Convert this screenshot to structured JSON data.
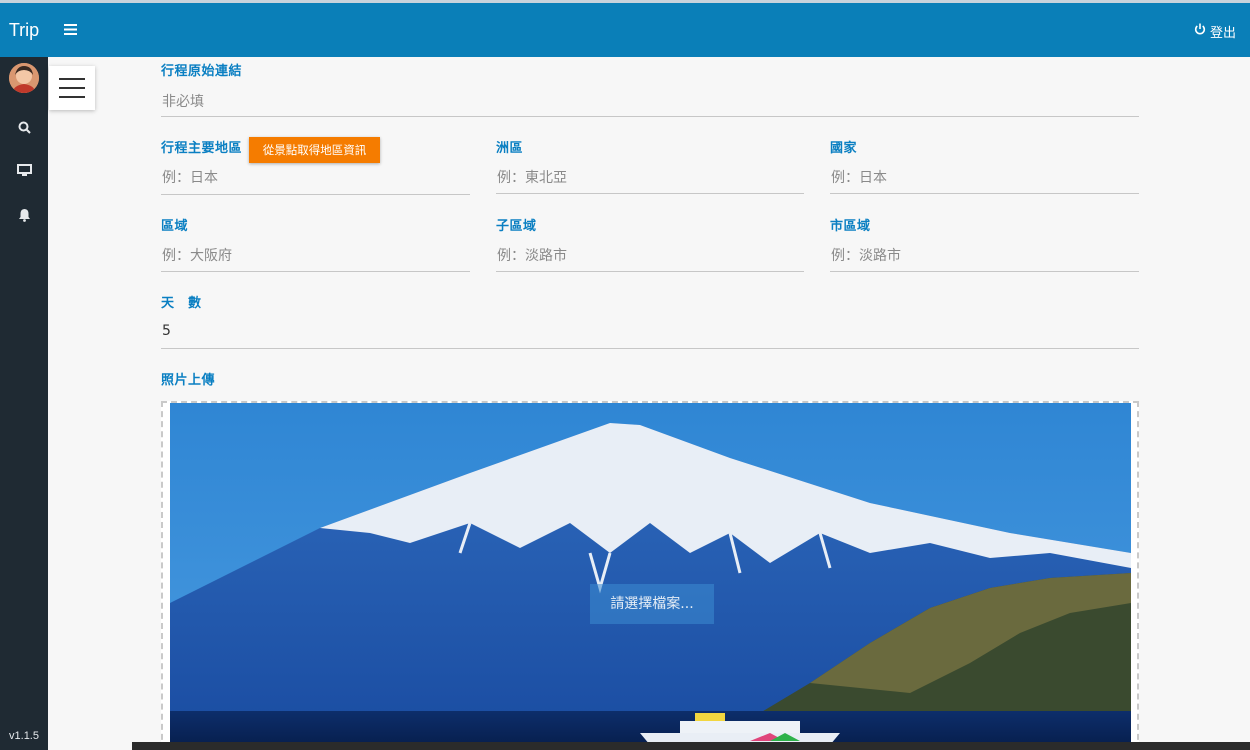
{
  "app": {
    "brand": "Trip",
    "version": "v1.1.5"
  },
  "sidebar": {
    "items": [
      {
        "icon": "search-icon"
      },
      {
        "icon": "monitor-icon"
      },
      {
        "icon": "bell-icon"
      }
    ]
  },
  "header": {
    "logout_label": "登出",
    "logout_icon": "power-icon",
    "menu_icon": "hamburger-icon"
  },
  "form": {
    "original_link": {
      "label": "行程原始連結",
      "placeholder": "非必填"
    },
    "main_region": {
      "label": "行程主要地區",
      "button_label": "從景點取得地區資訊",
      "placeholder": "例：日本"
    },
    "continent": {
      "label": "洲區",
      "placeholder": "例：東北亞"
    },
    "country": {
      "label": "國家",
      "placeholder": "例：日本"
    },
    "region": {
      "label": "區域",
      "placeholder": "例：大阪府"
    },
    "subregion": {
      "label": "子區域",
      "placeholder": "例：淡路市"
    },
    "city": {
      "label": "市區域",
      "placeholder": "例：淡路市"
    },
    "days": {
      "label": "天　數",
      "value": "5"
    },
    "photo_upload": {
      "label": "照片上傳",
      "choose_label": "請選擇檔案..."
    }
  },
  "colors": {
    "accent": "#0a7fb8",
    "sidebar": "#1f2a33",
    "button": "#f57c00",
    "label": "#0a7fc2"
  }
}
